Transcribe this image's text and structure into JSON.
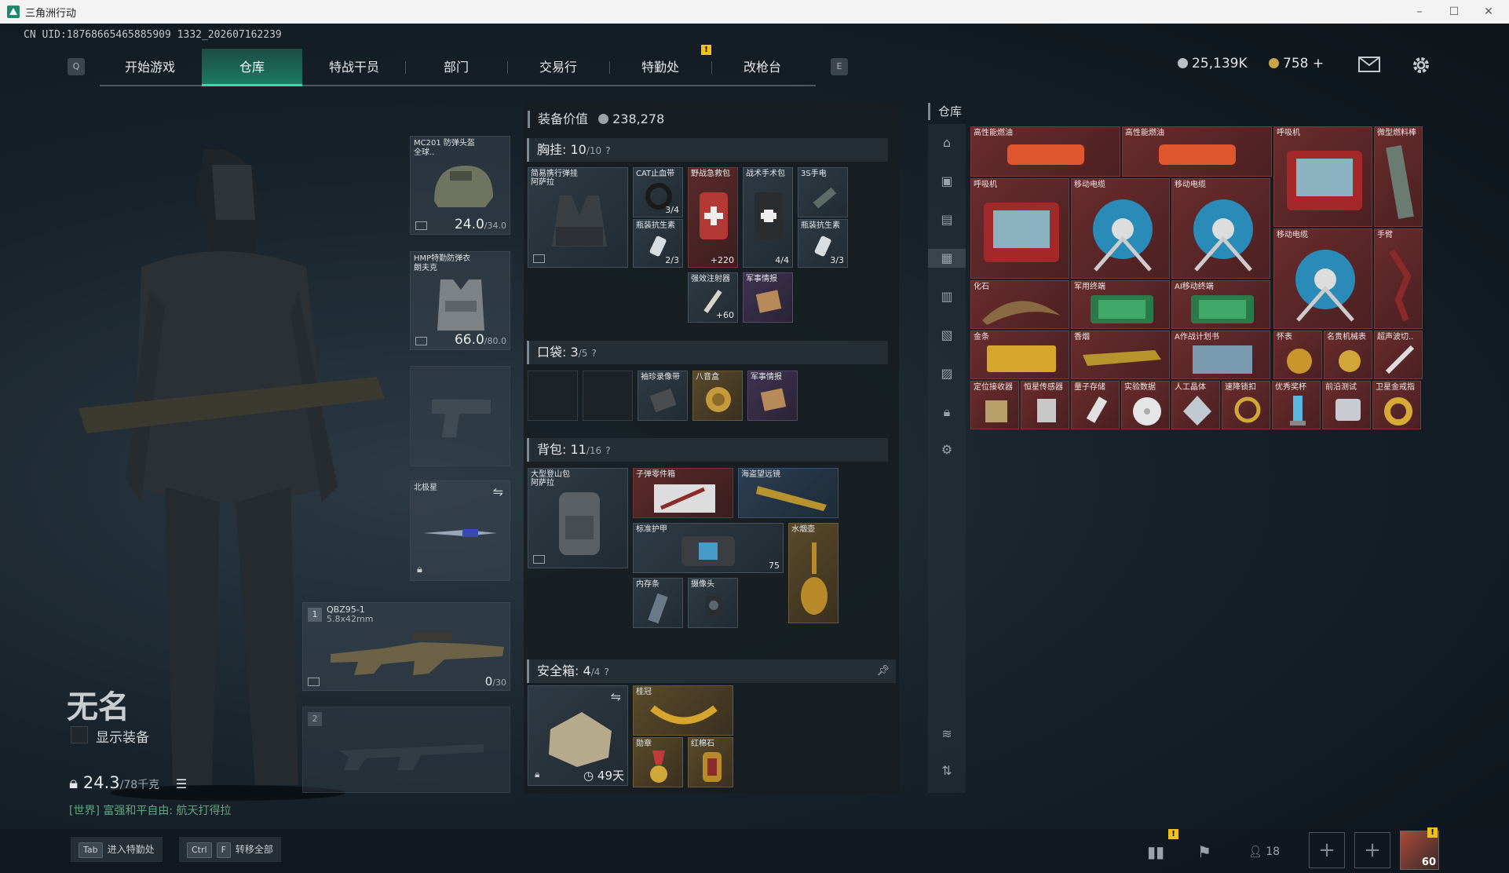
{
  "window": {
    "title": "三角洲行动",
    "min": "–",
    "max": "☐",
    "close": "✕"
  },
  "uid": "CN UID:18768665465885909 1332_202607162239",
  "nav": {
    "key_left": "Q",
    "key_right": "E",
    "tabs": [
      "开始游戏",
      "仓库",
      "特战干员",
      "部门",
      "交易行",
      "特勤处",
      "改枪台"
    ],
    "active_tab": "仓库",
    "badge": "!"
  },
  "currency": {
    "silver": "25,139K",
    "gold": "758",
    "gold_plus": "+"
  },
  "operator": {
    "name": "无名",
    "show_equip": "显示装备",
    "weight_value": "24.3",
    "weight_max": "/78千克",
    "chat_channel": "[世界]",
    "chat_text": "富强和平自由: 航天打得拉"
  },
  "slots": {
    "helmet": {
      "label": "MC201 防弹头盔\n全球..",
      "durability": "24.0",
      "durability_max": "/34.0"
    },
    "armor": {
      "label": "HMP特勤防弹衣\n朗夫克",
      "durability": "66.0",
      "durability_max": "/80.0"
    },
    "melee": {
      "label": "北极星"
    },
    "weapon1": {
      "index": "1",
      "name": "QBZ95-1",
      "caliber": "5.8x42mm",
      "ammo": "0",
      "ammo_max": "/30"
    },
    "weapon2": {
      "index": "2"
    }
  },
  "equipment": {
    "value_label": "装备价值",
    "value": "238,278",
    "rig": {
      "label": "胸挂:",
      "count": "10",
      "max": "/10",
      "help": "?"
    },
    "pockets": {
      "label": "口袋:",
      "count": "3",
      "max": "/5",
      "help": "?"
    },
    "backpack": {
      "label": "背包:",
      "count": "11",
      "max": "/16",
      "help": "?"
    },
    "safebox": {
      "label": "安全箱:",
      "count": "4",
      "max": "/4",
      "help": "?",
      "timer": "49天"
    },
    "rig_items": [
      {
        "label": "简易携行弹挂\n阿萨拉"
      },
      {
        "label": "CAT止血带",
        "count": "3/4"
      },
      {
        "label": "野战急救包",
        "count": "+220"
      },
      {
        "label": "战术手术包",
        "count": "4/4"
      },
      {
        "label": "3S手电"
      },
      {
        "label": "瓶装抗生素",
        "count": "2/3"
      },
      {
        "label": "瓶装抗生素",
        "count": "3/3"
      },
      {
        "label": "强效注射器",
        "count": "+60"
      },
      {
        "label": "军事情报"
      }
    ],
    "pocket_items": [
      {
        "label": "袖珍录像带"
      },
      {
        "label": "八音盒"
      },
      {
        "label": "军事情报"
      }
    ],
    "backpack_items": [
      {
        "label": "大型登山包\n阿萨拉"
      },
      {
        "label": "子弹零件箱"
      },
      {
        "label": "海盗望远镜"
      },
      {
        "label": "标准护甲",
        "count": "75"
      },
      {
        "label": "水烟壶"
      },
      {
        "label": "内存条"
      },
      {
        "label": "摄像头"
      }
    ],
    "safebox_items": [
      {
        "label": "桂冠"
      },
      {
        "label": "勋章"
      },
      {
        "label": "红棉石"
      }
    ]
  },
  "storage": {
    "title": "仓库",
    "items": [
      "高性能燃油",
      "高性能燃油",
      "呼吸机",
      "微型燃料棒",
      "呼吸机",
      "移动电缆",
      "移动电缆",
      "移动电缆",
      "手臂",
      "化石",
      "军用终端",
      "AI移动终端",
      "金条",
      "香烟",
      "A作战计划书",
      "怀表",
      "名贵机械表",
      "超声波切..",
      "定位接收器",
      "恒星传感器",
      "量子存储",
      "实验数据",
      "人工晶体",
      "速降锁扣",
      "优秀奖杯",
      "前沿测试",
      "卫星金戒指"
    ]
  },
  "bottom": {
    "hint1_key": "Tab",
    "hint1": "进入特勤处",
    "hint2_key1": "Ctrl",
    "hint2_key2": "F",
    "hint2": "转移全部",
    "squad_count": "18",
    "avatar_level": "60"
  },
  "colors": {
    "accent": "#2fe0a6",
    "tab_active": "#1a7a62",
    "storage_cell": "#6a2c2c",
    "badge": "#f0c020"
  }
}
